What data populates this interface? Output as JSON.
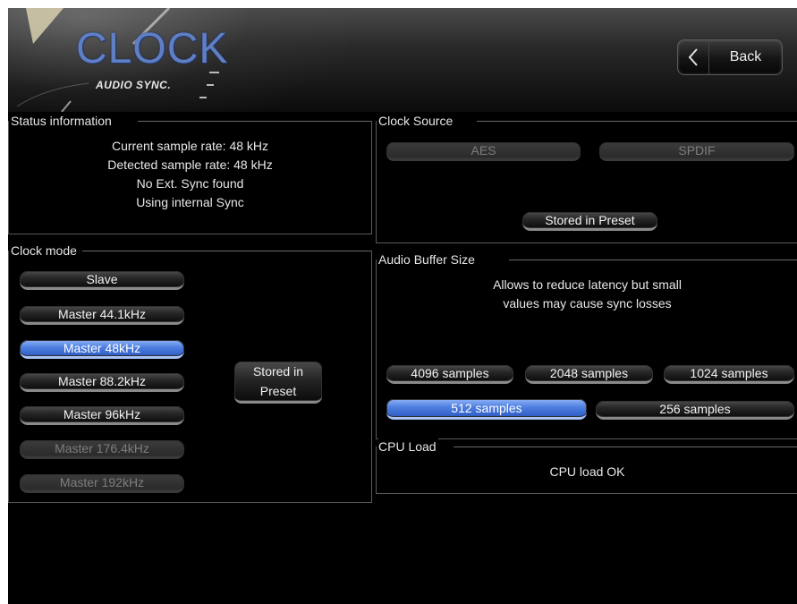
{
  "header": {
    "logo_title": "CLOCK",
    "logo_subtitle": "AUDIO SYNC.",
    "back_label": "Back"
  },
  "status": {
    "title": "Status information",
    "lines": [
      "Current sample rate: 48 kHz",
      "Detected sample rate: 48 kHz",
      "No Ext. Sync found",
      "Using internal Sync"
    ]
  },
  "clock_source": {
    "title": "Clock Source",
    "options": [
      "AES",
      "SPDIF"
    ],
    "stored_label": "Stored in Preset"
  },
  "clock_mode": {
    "title": "Clock mode",
    "options": [
      {
        "label": "Slave",
        "state": "normal"
      },
      {
        "label": "Master 44.1kHz",
        "state": "normal"
      },
      {
        "label": "Master 48kHz",
        "state": "selected"
      },
      {
        "label": "Master 88.2kHz",
        "state": "normal"
      },
      {
        "label": "Master 96kHz",
        "state": "normal"
      },
      {
        "label": "Master 176.4kHz",
        "state": "disabled"
      },
      {
        "label": "Master 192kHz",
        "state": "disabled"
      }
    ],
    "stored_line1": "Stored in",
    "stored_line2": "Preset"
  },
  "buffer": {
    "title": "Audio Buffer Size",
    "desc_line1": "Allows to reduce latency but small",
    "desc_line2": "values may cause sync losses",
    "options": [
      {
        "label": "4096 samples",
        "state": "normal"
      },
      {
        "label": "2048 samples",
        "state": "normal"
      },
      {
        "label": "1024 samples",
        "state": "normal"
      },
      {
        "label": "512 samples",
        "state": "selected"
      },
      {
        "label": "256 samples",
        "state": "normal"
      }
    ]
  },
  "cpu": {
    "title": "CPU Load",
    "status": "CPU load OK"
  },
  "colors": {
    "accent": "#4e7fe0",
    "logo": "#5f7fc4"
  },
  "icons": {
    "back": "chevron-left-icon"
  }
}
